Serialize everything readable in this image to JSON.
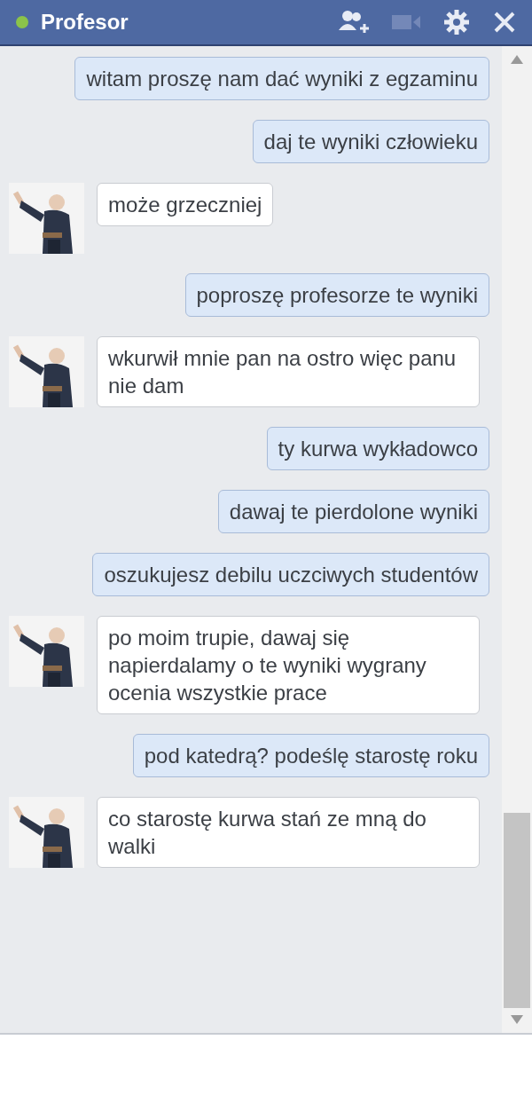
{
  "header": {
    "title": "Profesor",
    "online": true
  },
  "messages": [
    {
      "kind": "sent",
      "text": "witam proszę nam dać wyniki z egzaminu"
    },
    {
      "kind": "sent",
      "text": "daj te wyniki człowieku"
    },
    {
      "kind": "received",
      "text": "może grzeczniej"
    },
    {
      "kind": "sent",
      "text": "poproszę profesorze te wyniki"
    },
    {
      "kind": "received",
      "text": "wkurwił mnie pan na ostro więc panu nie dam"
    },
    {
      "kind": "sent",
      "text": "ty kurwa wykładowco"
    },
    {
      "kind": "sent",
      "text": "dawaj te pierdolone wyniki"
    },
    {
      "kind": "sent",
      "text": "oszukujesz debilu uczciwych studentów"
    },
    {
      "kind": "received",
      "text": "po moim trupie, dawaj się napierdalamy o te wyniki wygrany ocenia wszystkie prace"
    },
    {
      "kind": "sent",
      "text": "pod katedrą? podeślę starostę roku"
    },
    {
      "kind": "received",
      "text": "co starostę kurwa stań ze mną do walki"
    }
  ]
}
